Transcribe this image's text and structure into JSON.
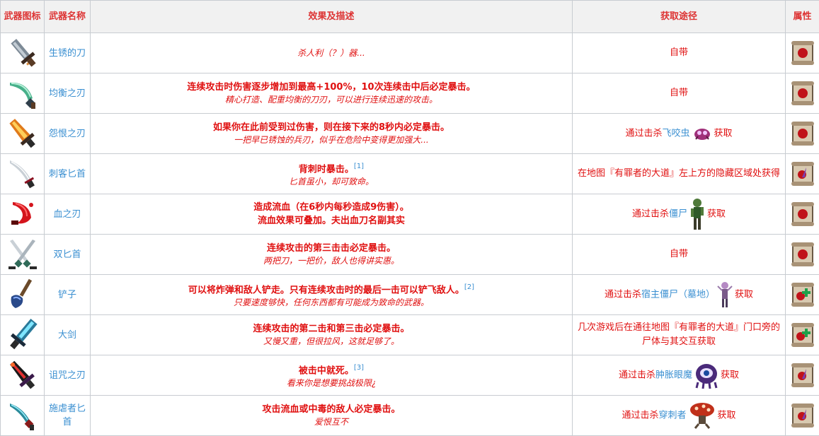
{
  "header": {
    "icon": "武器图标",
    "name": "武器名称",
    "desc": "效果及描述",
    "source": "获取途径",
    "attr": "属性"
  },
  "colors": {
    "accent": "#e01010",
    "link": "#3a8fd1",
    "header_bg": "#f1f1f1",
    "border": "#c8ccd1"
  },
  "weapons": [
    {
      "icon": "rusty-sword-icon",
      "name": "生锈的刀",
      "effect": "",
      "flavor": "杀人利（？）器...",
      "source": "自带",
      "attr": "brutality-scroll-icon"
    },
    {
      "icon": "balanced-blade-icon",
      "name": "均衡之刃",
      "effect": "连续攻击时伤害逐步增加到最高+100%，10次连续击中后必定暴击。",
      "flavor": "精心打造、配重均衡的刀刃，可以进行连续迅速的攻击。",
      "source": "自带",
      "attr": "brutality-scroll-icon"
    },
    {
      "icon": "spite-sword-icon",
      "name": "怨恨之刃",
      "effect": "如果你在此前受到过伤害，则在接下来的8秒内必定暴击。",
      "flavor": "一把早已锈蚀的兵刃，似乎在危险中变得更加强大...",
      "source_pre": "通过击杀",
      "source_link": "飞咬虫",
      "source_post": "获取",
      "mob": "biter-icon",
      "attr": "brutality-scroll-icon"
    },
    {
      "icon": "assassin-dagger-icon",
      "name": "刺客匕首",
      "effect": "背刺时暴击。",
      "ref": "[1]",
      "flavor": "匕首虽小，却可致命。",
      "source": "在地图『有罪者的大道』左上方的隐藏区域处获得",
      "attr": "tactics-scroll-icon"
    },
    {
      "icon": "blood-sword-icon",
      "name": "血之刃",
      "effect": "造成流血（在6秒内每秒造成9伤害）。",
      "effect2": "流血效果可叠加。夫出血刀名副其实",
      "flavor": "",
      "source_pre": "通过击杀",
      "source_link": "僵尸",
      "source_post": "获取",
      "mob": "zombie-icon",
      "attr": "brutality-scroll-icon"
    },
    {
      "icon": "twin-daggers-icon",
      "name": "双匕首",
      "effect": "连续攻击的第三击击必定暴击。",
      "flavor": "两把刀，一把价，敌人也得讲实惠。",
      "source": "自带",
      "attr": "brutality-scroll-icon"
    },
    {
      "icon": "shovel-icon",
      "name": "铲子",
      "effect": "可以将炸弹和敌人铲走。只有连续攻击时的最后一击可以铲飞敌人。",
      "ref": "[2]",
      "flavor": "只要速度够快，任何东西都有可能成为致命的武器。",
      "source_pre": "通过击杀",
      "source_link": "宿主僵尸（墓地）",
      "source_post": "获取",
      "mob": "host-zombie-icon",
      "attr": "survival-scroll-icon"
    },
    {
      "icon": "broadsword-icon",
      "name": "大剑",
      "effect": "连续攻击的第二击和第三击必定暴击。",
      "flavor": "又慢又重，但很拉风，这就足够了。",
      "source": "几次游戏后在通往地图『有罪者的大道』门口旁的尸体与其交互获取",
      "attr": "survival-scroll-icon"
    },
    {
      "icon": "cursed-sword-icon",
      "name": "诅咒之刃",
      "effect": "被击中就死。",
      "ref": "[3]",
      "flavor": "看来你是想要挑战极限¿",
      "source_pre": "通过击杀",
      "source_link": "肿胀眼魔",
      "source_post": "获取",
      "mob": "eye-monster-icon",
      "attr": "tactics-scroll-icon"
    },
    {
      "icon": "sadist-dagger-icon",
      "name": "施虐者匕首",
      "effect": "攻击流血或中毒的敌人必定暴击。",
      "flavor": "爱恨互不",
      "source_pre": "通过击杀",
      "source_link": "穿刺者",
      "source_post": "获取",
      "mob": "impaler-icon",
      "attr": "tactics-scroll-icon"
    }
  ]
}
